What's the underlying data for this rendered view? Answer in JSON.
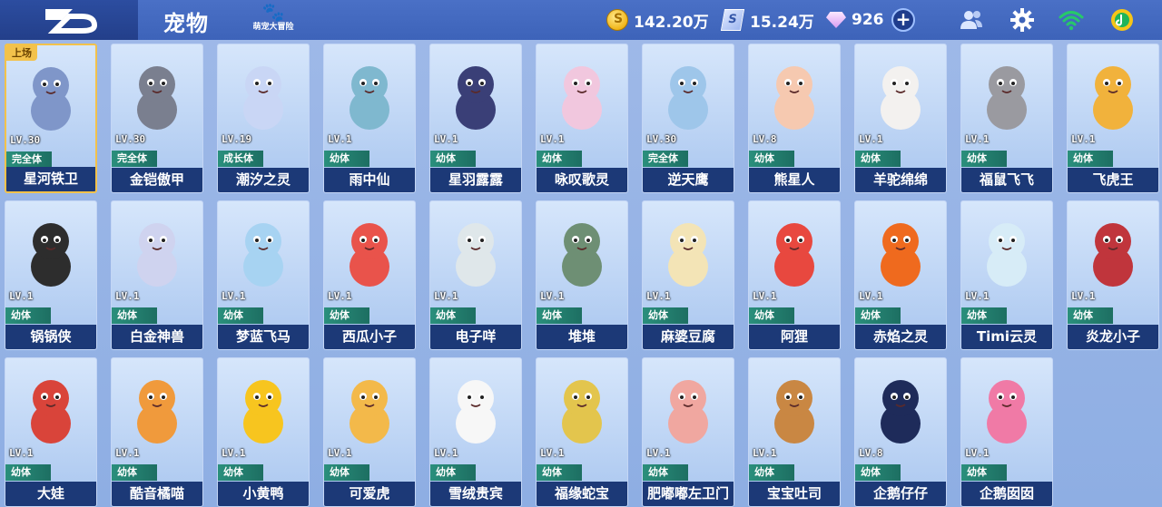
{
  "header": {
    "title": "宠物",
    "badge_sub": "萌宠大冒险",
    "gold": "142.20万",
    "tickets": "15.24万",
    "gems": "926",
    "plus": "+"
  },
  "labels": {
    "on_field": "上场"
  },
  "pets": [
    {
      "name": "星河铁卫",
      "level": "LV.30",
      "stage": "完全体",
      "on_field": true,
      "color": "#7f96c9"
    },
    {
      "name": "金铠傲甲",
      "level": "LV.30",
      "stage": "完全体",
      "on_field": false,
      "color": "#7a7f8f"
    },
    {
      "name": "潮汐之灵",
      "level": "LV.19",
      "stage": "成长体",
      "on_field": false,
      "color": "#c9d6f5"
    },
    {
      "name": "雨中仙",
      "level": "LV.1",
      "stage": "幼体",
      "on_field": false,
      "color": "#7fb8cf"
    },
    {
      "name": "星羽露露",
      "level": "LV.1",
      "stage": "幼体",
      "on_field": false,
      "color": "#3a3f77"
    },
    {
      "name": "咏叹歌灵",
      "level": "LV.1",
      "stage": "幼体",
      "on_field": false,
      "color": "#f1c7de"
    },
    {
      "name": "逆天鹰",
      "level": "LV.30",
      "stage": "完全体",
      "on_field": false,
      "color": "#9ec6ea"
    },
    {
      "name": "熊星人",
      "level": "LV.8",
      "stage": "幼体",
      "on_field": false,
      "color": "#f6c9b0"
    },
    {
      "name": "羊驼绵绵",
      "level": "LV.1",
      "stage": "幼体",
      "on_field": false,
      "color": "#f3f1ef"
    },
    {
      "name": "福鼠飞飞",
      "level": "LV.1",
      "stage": "幼体",
      "on_field": false,
      "color": "#9a9aa0"
    },
    {
      "name": "飞虎王",
      "level": "LV.1",
      "stage": "幼体",
      "on_field": false,
      "color": "#f1b23c"
    },
    {
      "name": "锅锅侠",
      "level": "LV.1",
      "stage": "幼体",
      "on_field": false,
      "color": "#2d2d2d"
    },
    {
      "name": "白金神兽",
      "level": "LV.1",
      "stage": "幼体",
      "on_field": false,
      "color": "#cfd3ef"
    },
    {
      "name": "梦蓝飞马",
      "level": "LV.1",
      "stage": "幼体",
      "on_field": false,
      "color": "#a7d3f2"
    },
    {
      "name": "西瓜小子",
      "level": "LV.1",
      "stage": "幼体",
      "on_field": false,
      "color": "#e9534b"
    },
    {
      "name": "电子咩",
      "level": "LV.1",
      "stage": "幼体",
      "on_field": false,
      "color": "#dfe7ea"
    },
    {
      "name": "堆堆",
      "level": "LV.1",
      "stage": "幼体",
      "on_field": false,
      "color": "#6e8f74"
    },
    {
      "name": "麻婆豆腐",
      "level": "LV.1",
      "stage": "幼体",
      "on_field": false,
      "color": "#f3e4b6"
    },
    {
      "name": "阿狸",
      "level": "LV.1",
      "stage": "幼体",
      "on_field": false,
      "color": "#e8483f"
    },
    {
      "name": "赤焰之灵",
      "level": "LV.1",
      "stage": "幼体",
      "on_field": false,
      "color": "#ef6a1e"
    },
    {
      "name": "Timi云灵",
      "level": "LV.1",
      "stage": "幼体",
      "on_field": false,
      "color": "#d7ecf7"
    },
    {
      "name": "炎龙小子",
      "level": "LV.1",
      "stage": "幼体",
      "on_field": false,
      "color": "#c0353c"
    },
    {
      "name": "大娃",
      "level": "LV.1",
      "stage": "幼体",
      "on_field": false,
      "color": "#d9443a"
    },
    {
      "name": "酷音橘喵",
      "level": "LV.1",
      "stage": "幼体",
      "on_field": false,
      "color": "#f09a3c"
    },
    {
      "name": "小黄鸭",
      "level": "LV.1",
      "stage": "幼体",
      "on_field": false,
      "color": "#f7c51f"
    },
    {
      "name": "可爱虎",
      "level": "LV.1",
      "stage": "幼体",
      "on_field": false,
      "color": "#f3b94a"
    },
    {
      "name": "雪绒贵宾",
      "level": "LV.1",
      "stage": "幼体",
      "on_field": false,
      "color": "#f7f7f7"
    },
    {
      "name": "福缘蛇宝",
      "level": "LV.1",
      "stage": "幼体",
      "on_field": false,
      "color": "#e3c54d"
    },
    {
      "name": "肥嘟嘟左卫门",
      "level": "LV.1",
      "stage": "幼体",
      "on_field": false,
      "color": "#f0a7a0"
    },
    {
      "name": "宝宝吐司",
      "level": "LV.1",
      "stage": "幼体",
      "on_field": false,
      "color": "#c98743"
    },
    {
      "name": "企鹅仔仔",
      "level": "LV.8",
      "stage": "幼体",
      "on_field": false,
      "color": "#1e2b5a"
    },
    {
      "name": "企鹅囡囡",
      "level": "LV.1",
      "stage": "幼体",
      "on_field": false,
      "color": "#f07aa6"
    }
  ],
  "icons": [
    "friends-icon",
    "gear-icon",
    "wifi-icon",
    "qq-music-icon"
  ]
}
